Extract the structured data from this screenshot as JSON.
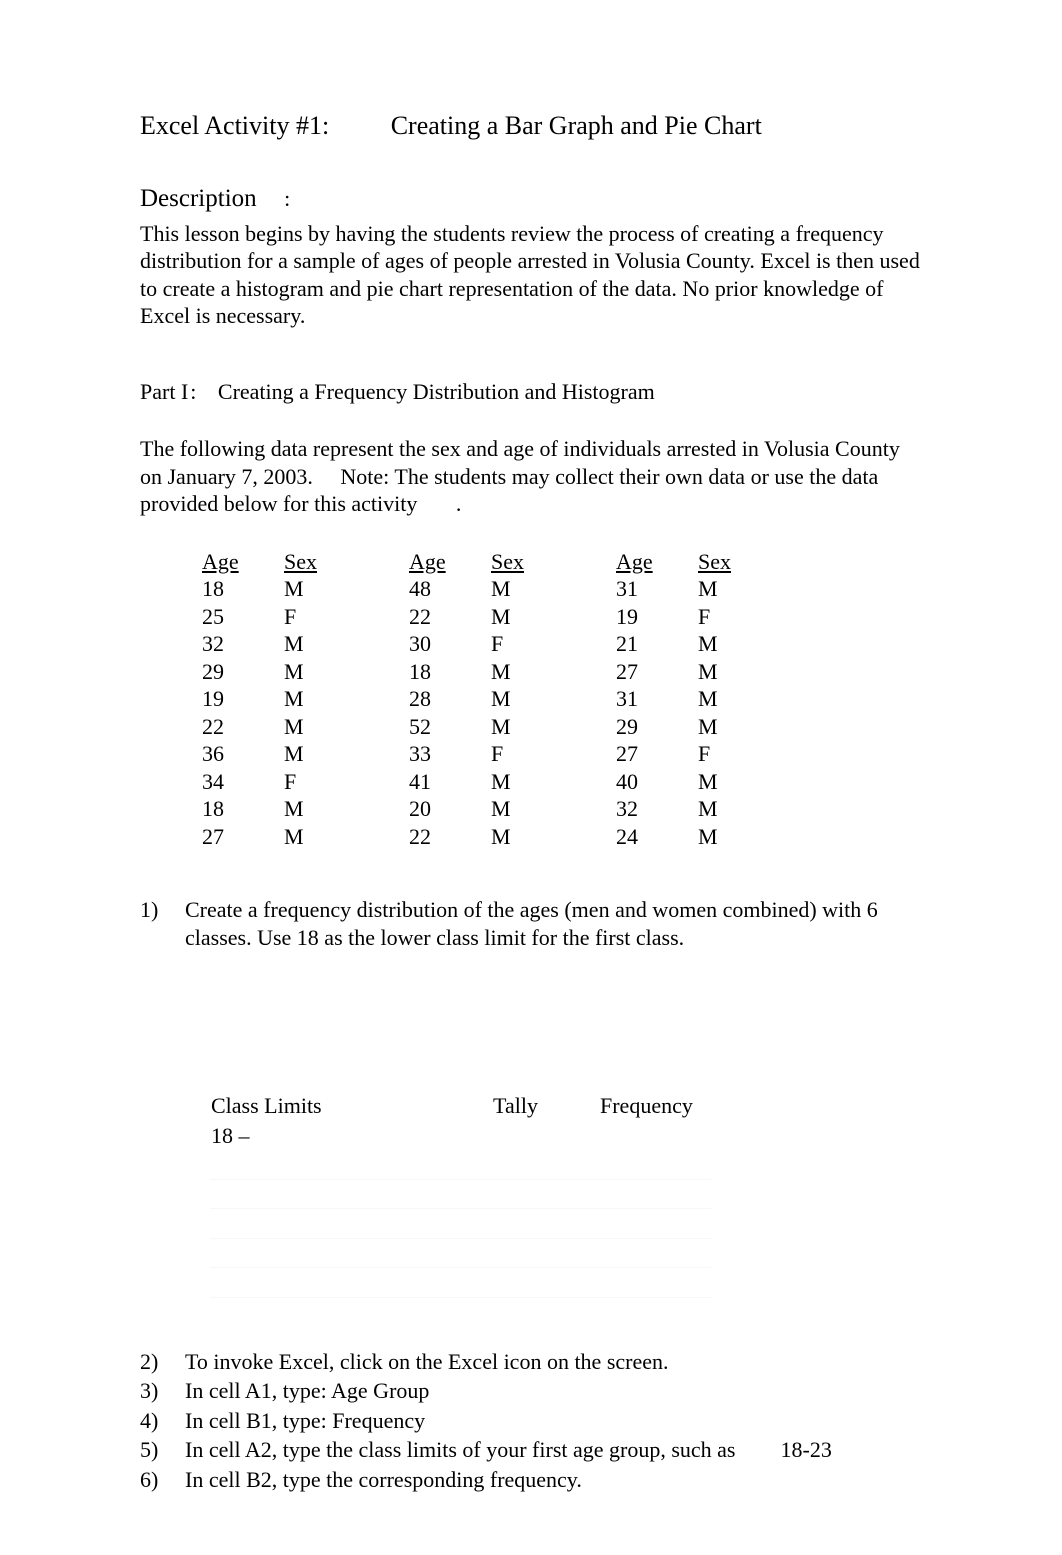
{
  "title": {
    "label": "Excel Activity #1:",
    "text": "Creating a Bar Graph and Pie Chart"
  },
  "description": {
    "heading": "Description",
    "colon": ":",
    "body": "This lesson begins by having the students review the process of creating a frequency distribution for a sample of ages of people arrested in Volusia County. Excel is then used to create a histogram and pie chart representation of the data. No prior knowledge of Excel is necessary."
  },
  "part1": {
    "label": "Part I",
    "colon": ":",
    "text": "Creating a Frequency Distribution and Histogram"
  },
  "intro": {
    "text": "The following data represent the sex and age of individuals arrested in Volusia County on January 7, 2003.",
    "note": "Note: The students may collect their own data or use the data provided below for this activity",
    "period": "."
  },
  "data": {
    "headers": {
      "age": "Age",
      "sex": "Sex"
    },
    "columns": [
      [
        {
          "age": "18",
          "sex": "M"
        },
        {
          "age": "25",
          "sex": "F"
        },
        {
          "age": "32",
          "sex": "M"
        },
        {
          "age": "29",
          "sex": "M"
        },
        {
          "age": "19",
          "sex": "M"
        },
        {
          "age": "22",
          "sex": "M"
        },
        {
          "age": "36",
          "sex": "M"
        },
        {
          "age": "34",
          "sex": "F"
        },
        {
          "age": "18",
          "sex": "M"
        },
        {
          "age": "27",
          "sex": "M"
        }
      ],
      [
        {
          "age": "48",
          "sex": "M"
        },
        {
          "age": "22",
          "sex": "M"
        },
        {
          "age": "30",
          "sex": "F"
        },
        {
          "age": "18",
          "sex": "M"
        },
        {
          "age": "28",
          "sex": "M"
        },
        {
          "age": "52",
          "sex": "M"
        },
        {
          "age": "33",
          "sex": "F"
        },
        {
          "age": "41",
          "sex": "M"
        },
        {
          "age": "20",
          "sex": "M"
        },
        {
          "age": "22",
          "sex": "M"
        }
      ],
      [
        {
          "age": "31",
          "sex": "M"
        },
        {
          "age": "19",
          "sex": "F"
        },
        {
          "age": "21",
          "sex": "M"
        },
        {
          "age": "27",
          "sex": "M"
        },
        {
          "age": "31",
          "sex": "M"
        },
        {
          "age": "29",
          "sex": "M"
        },
        {
          "age": "27",
          "sex": "F"
        },
        {
          "age": "40",
          "sex": "M"
        },
        {
          "age": "32",
          "sex": "M"
        },
        {
          "age": "24",
          "sex": "M"
        }
      ]
    ]
  },
  "q1": {
    "num": "1)",
    "text": "Create a frequency distribution of the ages (men and women combined) with 6 classes. Use 18 as the lower class limit for the first class."
  },
  "tally": {
    "headers": {
      "class": "Class Limits",
      "tally": "Tally",
      "freq": "Frequency"
    },
    "first": "18 –",
    "blank_rows": 5
  },
  "steps": [
    {
      "num": "2)",
      "text": "To invoke Excel, click on the Excel icon on the screen."
    },
    {
      "num": "3)",
      "text": "In cell A1, type:  Age Group"
    },
    {
      "num": "4)",
      "text": "In cell B1, type:  Frequency"
    },
    {
      "num": "5)",
      "text": "In cell A2, type the class limits of your first age group, such as",
      "trail": "18-23"
    },
    {
      "num": "6)",
      "text": "In cell B2, type the corresponding frequency."
    }
  ]
}
